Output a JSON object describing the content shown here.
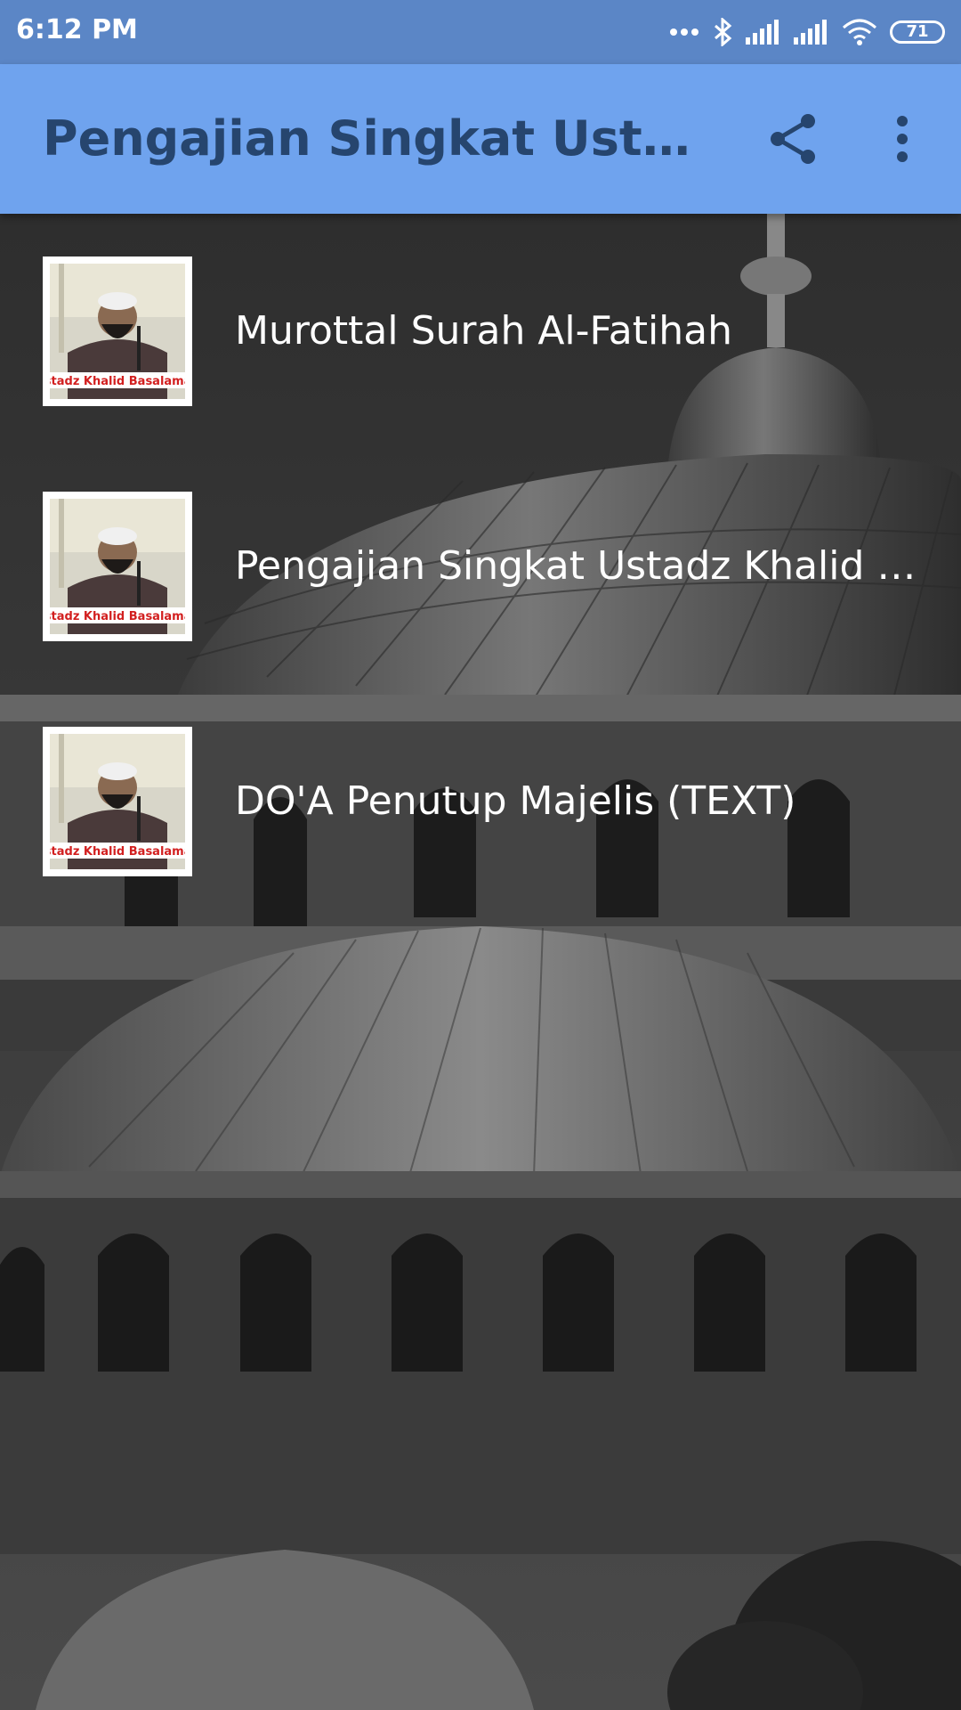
{
  "status_bar": {
    "time": "6:12 PM",
    "battery": "71",
    "icons": [
      "more-dots-icon",
      "bluetooth-icon",
      "signal-icon",
      "signal-icon",
      "wifi-icon",
      "battery-icon"
    ]
  },
  "app_bar": {
    "title": "Pengajian Singkat Ust. Khalid Basalamah",
    "actions": [
      "share-icon",
      "more-vert-icon"
    ]
  },
  "list": {
    "items": [
      {
        "label": "Murottal Surah Al-Fatihah",
        "thumb_caption": "Ustadz Khalid Basalamah"
      },
      {
        "label": "Pengajian Singkat Ustadz Khalid Basalamah",
        "thumb_caption": "Ustadz Khalid Basalamah"
      },
      {
        "label": "DO'A Penutup Majelis (TEXT)",
        "thumb_caption": "Ustadz Khalid Basalamah"
      }
    ]
  },
  "colors": {
    "status_bar": "#5b86c6",
    "app_bar": "#6fa3ee",
    "title_text": "#26456e",
    "list_text": "#ffffff"
  }
}
